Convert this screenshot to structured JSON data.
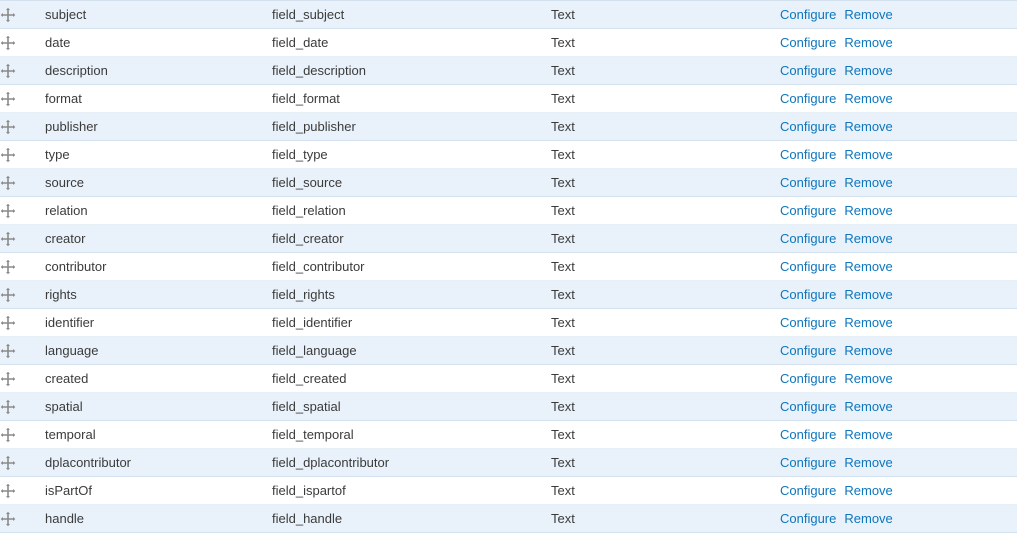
{
  "table": {
    "icons": {
      "drag_handle": "move-cross-icon"
    },
    "operations": {
      "configure_label": "Configure",
      "remove_label": "Remove"
    },
    "colors": {
      "link": "#0e76bc",
      "row_stripe": "#e9f1fa",
      "row_plain": "#ffffff",
      "row_border": "#d3e0ee",
      "text": "#3b3b3b"
    },
    "rows": [
      {
        "label": "subject",
        "machine_name": "field_subject",
        "field_type": "Text"
      },
      {
        "label": "date",
        "machine_name": "field_date",
        "field_type": "Text"
      },
      {
        "label": "description",
        "machine_name": "field_description",
        "field_type": "Text"
      },
      {
        "label": "format",
        "machine_name": "field_format",
        "field_type": "Text"
      },
      {
        "label": "publisher",
        "machine_name": "field_publisher",
        "field_type": "Text"
      },
      {
        "label": "type",
        "machine_name": "field_type",
        "field_type": "Text"
      },
      {
        "label": "source",
        "machine_name": "field_source",
        "field_type": "Text"
      },
      {
        "label": "relation",
        "machine_name": "field_relation",
        "field_type": "Text"
      },
      {
        "label": "creator",
        "machine_name": "field_creator",
        "field_type": "Text"
      },
      {
        "label": "contributor",
        "machine_name": "field_contributor",
        "field_type": "Text"
      },
      {
        "label": "rights",
        "machine_name": "field_rights",
        "field_type": "Text"
      },
      {
        "label": "identifier",
        "machine_name": "field_identifier",
        "field_type": "Text"
      },
      {
        "label": "language",
        "machine_name": "field_language",
        "field_type": "Text"
      },
      {
        "label": "created",
        "machine_name": "field_created",
        "field_type": "Text"
      },
      {
        "label": "spatial",
        "machine_name": "field_spatial",
        "field_type": "Text"
      },
      {
        "label": "temporal",
        "machine_name": "field_temporal",
        "field_type": "Text"
      },
      {
        "label": "dplacontributor",
        "machine_name": "field_dplacontributor",
        "field_type": "Text"
      },
      {
        "label": "isPartOf",
        "machine_name": "field_ispartof",
        "field_type": "Text"
      },
      {
        "label": "handle",
        "machine_name": "field_handle",
        "field_type": "Text"
      }
    ]
  }
}
